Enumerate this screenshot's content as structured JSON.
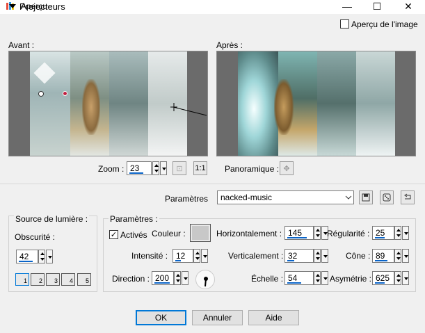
{
  "window": {
    "title": "Projecteurs",
    "minimize_glyph": "—",
    "maximize_glyph": "☐",
    "close_glyph": "✕"
  },
  "preview": {
    "toggle_label": "Aperçu",
    "checkbox_label": "Aperçu de l'image",
    "checkbox_checked": false,
    "before_label": "Avant :",
    "after_label": "Après :",
    "zoom_label": "Zoom :",
    "zoom_value": "23",
    "pan_label": "Panoramique :"
  },
  "settings": {
    "label": "Paramètres",
    "preset_value": "nacked-music"
  },
  "light_source": {
    "title": "Source de lumière :",
    "obscurity_label": "Obscurité :",
    "obscurity_value": "42",
    "lights": [
      "1",
      "2",
      "3",
      "4",
      "5"
    ]
  },
  "params": {
    "title": "Paramètres :",
    "active_label": "Activés",
    "active_checked": true,
    "color_label": "Couleur :",
    "intensity_label": "Intensité :",
    "intensity_value": "12",
    "direction_label": "Direction :",
    "direction_value": "200",
    "horizontal_label": "Horizontalement :",
    "horizontal_value": "145",
    "vertical_label": "Verticalement :",
    "vertical_value": "32",
    "scale_label": "Échelle :",
    "scale_value": "54",
    "regularity_label": "Régularité :",
    "regularity_value": "25",
    "cone_label": "Cône :",
    "cone_value": "89",
    "asymmetry_label": "Asymétrie :",
    "asymmetry_value": "625"
  },
  "buttons": {
    "ok": "OK",
    "cancel": "Annuler",
    "help": "Aide"
  },
  "colors": {
    "accent": "#0078d7",
    "spin_underline": "#0a64c8"
  }
}
